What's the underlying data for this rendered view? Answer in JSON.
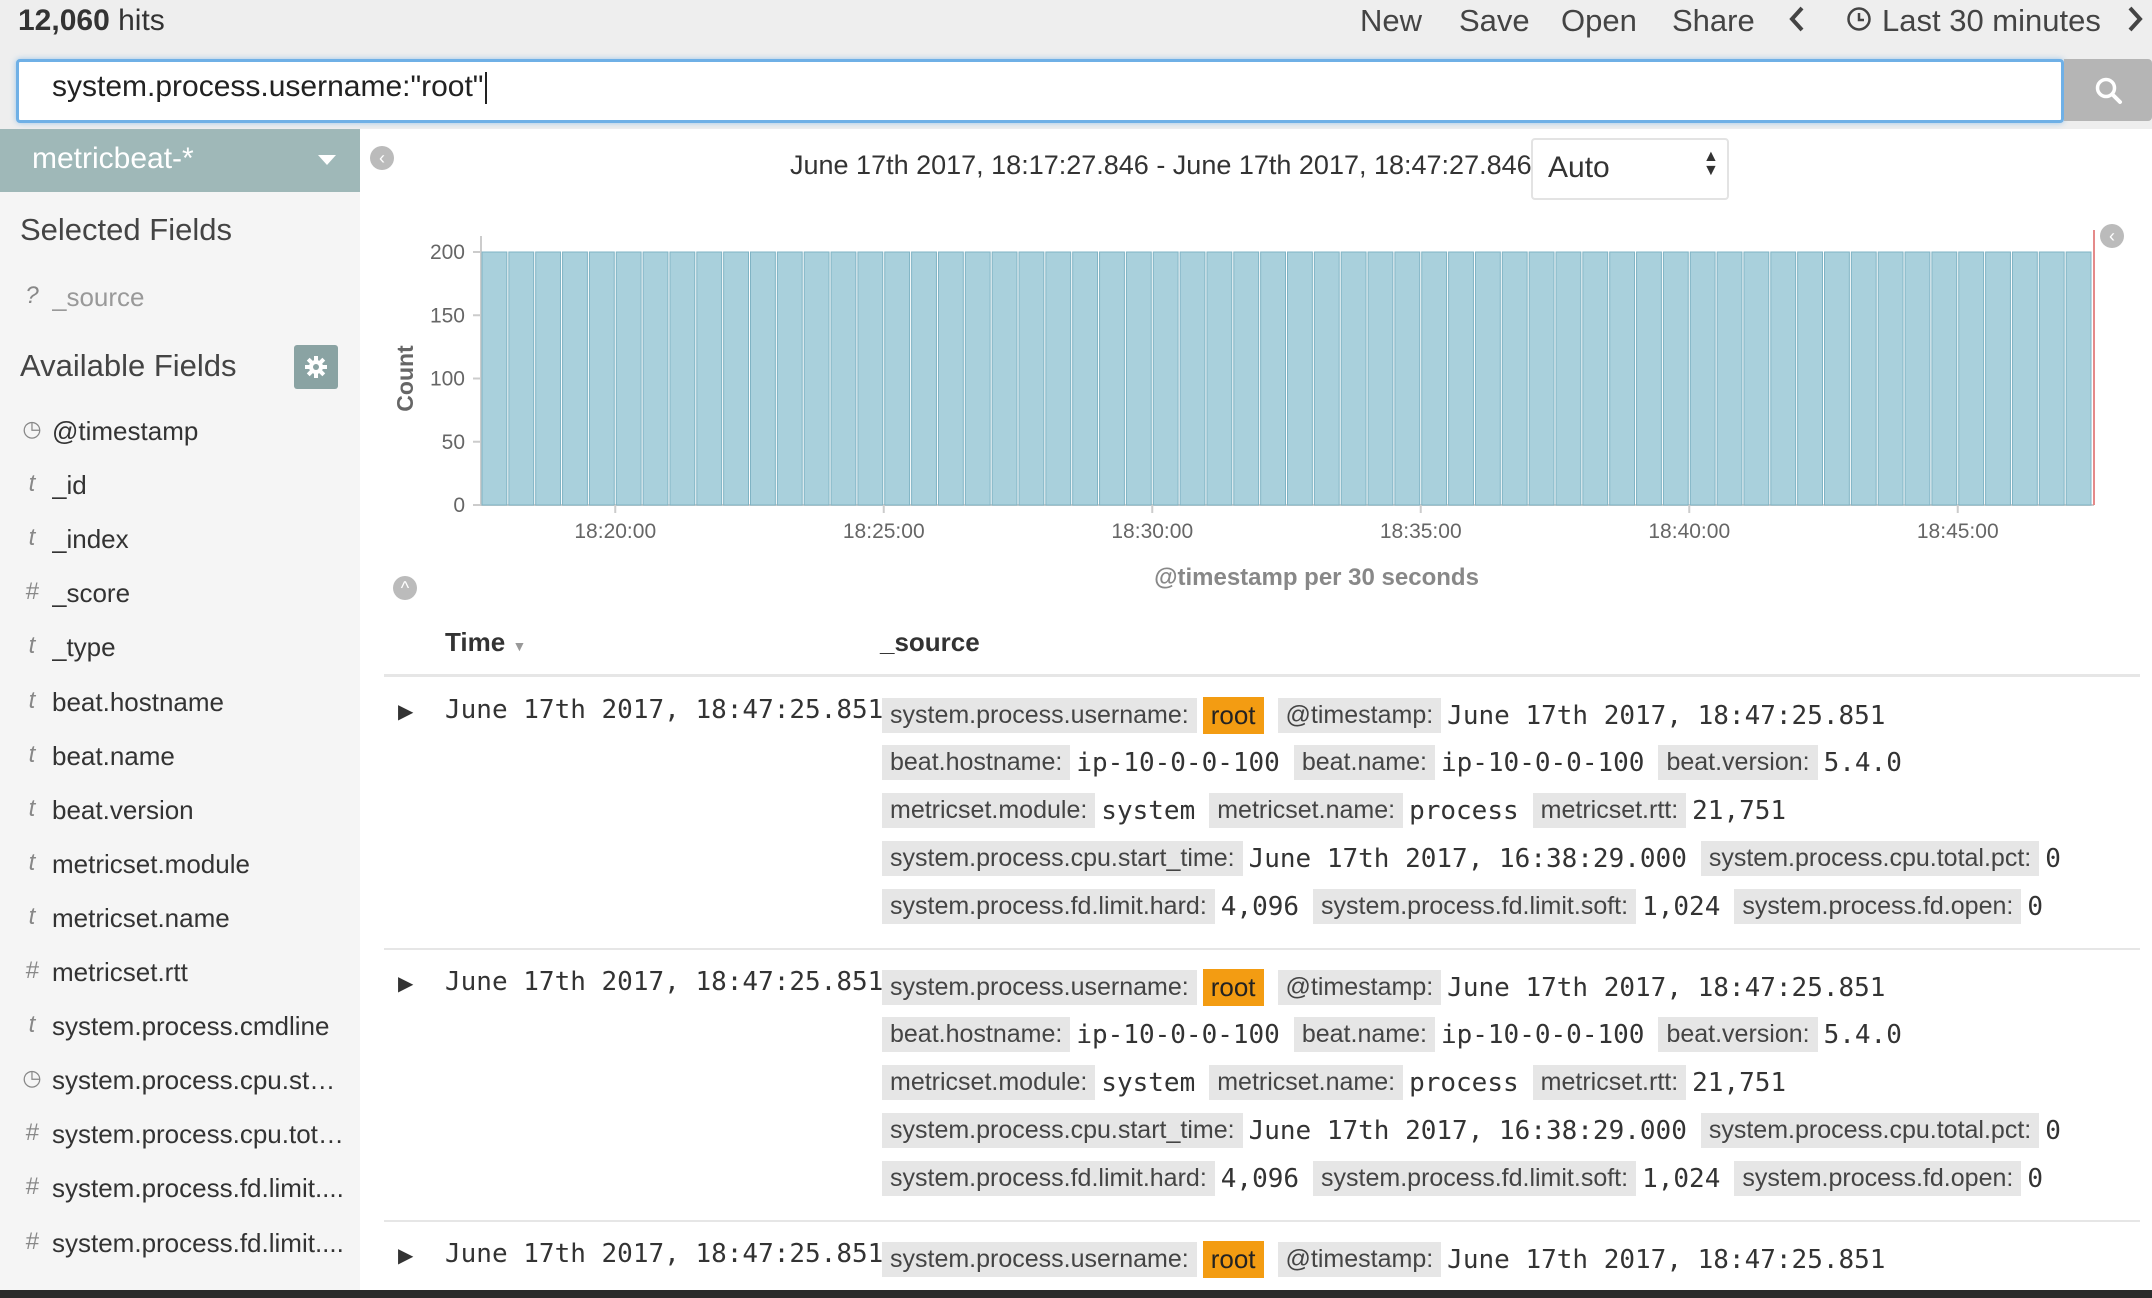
{
  "topbar": {
    "hits_count": "12,060",
    "hits_label": "hits",
    "menu": {
      "new": "New",
      "save": "Save",
      "open": "Open",
      "share": "Share"
    },
    "time_label": "Last 30 minutes"
  },
  "search": {
    "query": "system.process.username:\"root\""
  },
  "sidebar": {
    "index_pattern": "metricbeat-*",
    "selected_heading": "Selected Fields",
    "selected_fields": [
      {
        "type": "?",
        "name": "_source"
      }
    ],
    "available_heading": "Available Fields",
    "available_fields": [
      {
        "type": "clock",
        "name": "@timestamp"
      },
      {
        "type": "t",
        "name": "_id"
      },
      {
        "type": "t",
        "name": "_index"
      },
      {
        "type": "#",
        "name": "_score"
      },
      {
        "type": "t",
        "name": "_type"
      },
      {
        "type": "t",
        "name": "beat.hostname"
      },
      {
        "type": "t",
        "name": "beat.name"
      },
      {
        "type": "t",
        "name": "beat.version"
      },
      {
        "type": "t",
        "name": "metricset.module"
      },
      {
        "type": "t",
        "name": "metricset.name"
      },
      {
        "type": "#",
        "name": "metricset.rtt"
      },
      {
        "type": "t",
        "name": "system.process.cmdline"
      },
      {
        "type": "clock",
        "name": "system.process.cpu.star..."
      },
      {
        "type": "#",
        "name": "system.process.cpu.tota..."
      },
      {
        "type": "#",
        "name": "system.process.fd.limit...."
      },
      {
        "type": "#",
        "name": "system.process.fd.limit...."
      }
    ]
  },
  "timerange": {
    "text": "June 17th 2017, 18:17:27.846 - June 17th 2017, 18:47:27.846 —",
    "interval": "Auto"
  },
  "chart_data": {
    "type": "bar",
    "ylabel": "Count",
    "xlabel": "@timestamp per 30 seconds",
    "ylim": [
      0,
      200
    ],
    "yticks": [
      "0",
      "50",
      "100",
      "150",
      "200"
    ],
    "xticks": [
      "18:20:00",
      "18:25:00",
      "18:30:00",
      "18:35:00",
      "18:40:00",
      "18:45:00"
    ],
    "start": "18:17:30",
    "bucket_seconds": 30,
    "values": [
      200,
      200,
      200,
      200,
      200,
      200,
      200,
      200,
      200,
      200,
      200,
      200,
      200,
      200,
      200,
      200,
      200,
      200,
      200,
      200,
      200,
      200,
      200,
      200,
      200,
      200,
      200,
      200,
      200,
      200,
      200,
      200,
      200,
      200,
      200,
      200,
      200,
      200,
      200,
      200,
      200,
      200,
      200,
      200,
      200,
      200,
      200,
      200,
      200,
      200,
      200,
      200,
      200,
      200,
      200,
      200,
      200,
      200,
      200,
      200
    ],
    "bar_color": "#a9d0dc"
  },
  "table": {
    "col_time": "Time",
    "col_source": "_source",
    "rows": [
      {
        "time": "June 17th 2017, 18:47:25.851",
        "lines": [
          [
            [
              "system.process.username:",
              "root",
              "hl"
            ],
            [
              "@timestamp:",
              "June 17th 2017, 18:47:25.851"
            ]
          ],
          [
            [
              "beat.hostname:",
              "ip-10-0-0-100"
            ],
            [
              "beat.name:",
              "ip-10-0-0-100"
            ],
            [
              "beat.version:",
              "5.4.0"
            ]
          ],
          [
            [
              "metricset.module:",
              "system"
            ],
            [
              "metricset.name:",
              "process"
            ],
            [
              "metricset.rtt:",
              "21,751"
            ]
          ],
          [
            [
              "system.process.cpu.start_time:",
              "June 17th 2017, 16:38:29.000"
            ],
            [
              "system.process.cpu.total.pct:",
              "0"
            ]
          ],
          [
            [
              "system.process.fd.limit.hard:",
              "4,096"
            ],
            [
              "system.process.fd.limit.soft:",
              "1,024"
            ],
            [
              "system.process.fd.open:",
              "0"
            ]
          ]
        ]
      },
      {
        "time": "June 17th 2017, 18:47:25.851",
        "lines": [
          [
            [
              "system.process.username:",
              "root",
              "hl"
            ],
            [
              "@timestamp:",
              "June 17th 2017, 18:47:25.851"
            ]
          ],
          [
            [
              "beat.hostname:",
              "ip-10-0-0-100"
            ],
            [
              "beat.name:",
              "ip-10-0-0-100"
            ],
            [
              "beat.version:",
              "5.4.0"
            ]
          ],
          [
            [
              "metricset.module:",
              "system"
            ],
            [
              "metricset.name:",
              "process"
            ],
            [
              "metricset.rtt:",
              "21,751"
            ]
          ],
          [
            [
              "system.process.cpu.start_time:",
              "June 17th 2017, 16:38:29.000"
            ],
            [
              "system.process.cpu.total.pct:",
              "0"
            ]
          ],
          [
            [
              "system.process.fd.limit.hard:",
              "4,096"
            ],
            [
              "system.process.fd.limit.soft:",
              "1,024"
            ],
            [
              "system.process.fd.open:",
              "0"
            ]
          ]
        ]
      },
      {
        "time": "June 17th 2017, 18:47:25.851",
        "lines": [
          [
            [
              "system.process.username:",
              "root",
              "hl"
            ],
            [
              "@timestamp:",
              "June 17th 2017, 18:47:25.851"
            ]
          ]
        ]
      }
    ]
  }
}
